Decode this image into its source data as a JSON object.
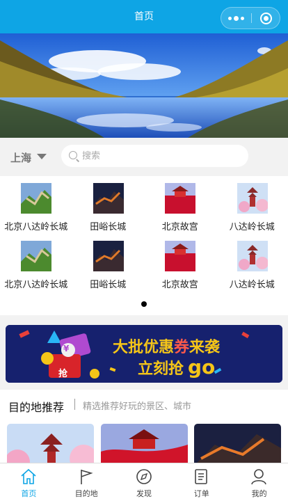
{
  "navbar": {
    "title": "首页"
  },
  "banner": {
    "image": "mountain-lake-landscape",
    "active_slide": 1
  },
  "search": {
    "city": "上海",
    "placeholder": "搜索"
  },
  "attractions": [
    {
      "name": "北京八达岭长城",
      "image": "great-wall-green"
    },
    {
      "name": "田峪长城",
      "image": "great-wall-night"
    },
    {
      "name": "北京故宫",
      "image": "forbidden-city-red"
    },
    {
      "name": "八达岭长城",
      "image": "pagoda-pink"
    },
    {
      "name": "北京八达岭长城",
      "image": "great-wall-green"
    },
    {
      "name": "田峪长城",
      "image": "great-wall-night"
    },
    {
      "name": "北京故宫",
      "image": "forbidden-city-red"
    },
    {
      "name": "八达岭长城",
      "image": "pagoda-pink"
    }
  ],
  "promo": {
    "headline_1": "大批优惠",
    "headline_2": "券",
    "headline_3": "来袭",
    "line2": "立刻抢",
    "go": "go",
    "badge": "抢",
    "voucher_symbol": "¥"
  },
  "recommend": {
    "title": "目的地推荐",
    "subtitle": "精选推荐好玩的景区、城市",
    "cards": [
      {
        "image": "pagoda-blossom"
      },
      {
        "image": "palace-red-silk"
      },
      {
        "image": "great-wall-autumn"
      }
    ]
  },
  "tabbar": {
    "active_color": "#0ea5e5",
    "items": [
      {
        "label": "首页",
        "icon": "home-icon",
        "active": true
      },
      {
        "label": "目的地",
        "icon": "flag-icon",
        "active": false
      },
      {
        "label": "发现",
        "icon": "compass-icon",
        "active": false
      },
      {
        "label": "订单",
        "icon": "order-icon",
        "active": false
      },
      {
        "label": "我的",
        "icon": "user-icon",
        "active": false
      }
    ]
  }
}
